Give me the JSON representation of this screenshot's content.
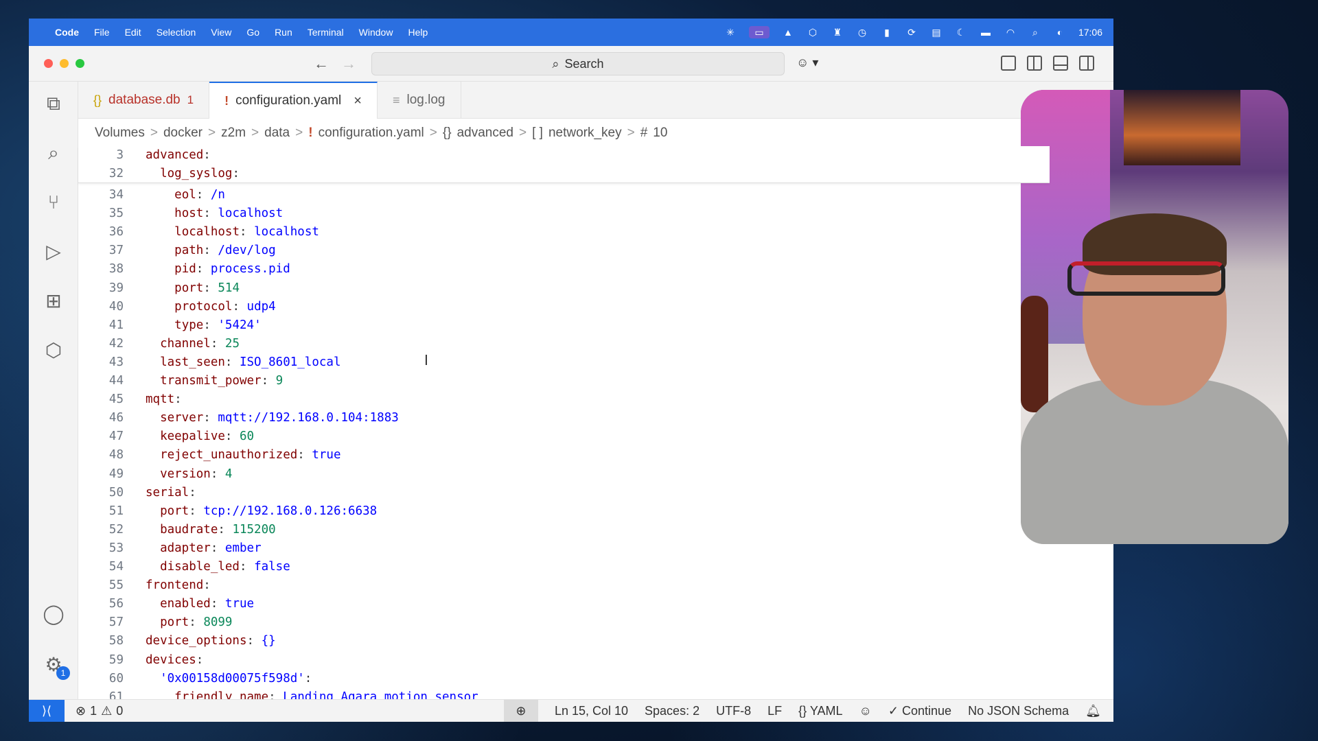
{
  "menubar": {
    "app": "Code",
    "items": [
      "File",
      "Edit",
      "Selection",
      "View",
      "Go",
      "Run",
      "Terminal",
      "Window",
      "Help"
    ],
    "clock": "17:06"
  },
  "titlebar": {
    "search_label": "Search"
  },
  "tabs": [
    {
      "label": "database.db",
      "icon": "{}",
      "badge": "1"
    },
    {
      "label": "configuration.yaml",
      "icon": "!",
      "close": "×"
    },
    {
      "label": "log.log",
      "icon": "≡"
    }
  ],
  "breadcrumbs": {
    "parts": [
      "Volumes",
      "docker",
      "z2m",
      "data"
    ],
    "file": "configuration.yaml",
    "symbol1": "advanced",
    "symbol2": "network_key",
    "symbol3": "10",
    "sym_obj": "{}",
    "sym_arr": "[ ]",
    "sym_num": "#",
    "sym_excl": "!",
    "separator": ">"
  },
  "editor": {
    "lines": [
      {
        "n": "3",
        "indent": "",
        "key": "advanced",
        "colon": ":",
        "val": "",
        "vtype": ""
      },
      {
        "n": "32",
        "indent": "  ",
        "key": "log_syslog",
        "colon": ":",
        "val": "",
        "vtype": ""
      },
      {
        "n": "34",
        "indent": "    ",
        "key": "eol",
        "colon": ": ",
        "val": "/n",
        "vtype": "val"
      },
      {
        "n": "35",
        "indent": "    ",
        "key": "host",
        "colon": ": ",
        "val": "localhost",
        "vtype": "val"
      },
      {
        "n": "36",
        "indent": "    ",
        "key": "localhost",
        "colon": ": ",
        "val": "localhost",
        "vtype": "val"
      },
      {
        "n": "37",
        "indent": "    ",
        "key": "path",
        "colon": ": ",
        "val": "/dev/log",
        "vtype": "val"
      },
      {
        "n": "38",
        "indent": "    ",
        "key": "pid",
        "colon": ": ",
        "val": "process.pid",
        "vtype": "val"
      },
      {
        "n": "39",
        "indent": "    ",
        "key": "port",
        "colon": ": ",
        "val": "514",
        "vtype": "num"
      },
      {
        "n": "40",
        "indent": "    ",
        "key": "protocol",
        "colon": ": ",
        "val": "udp4",
        "vtype": "val"
      },
      {
        "n": "41",
        "indent": "    ",
        "key": "type",
        "colon": ": ",
        "val": "'5424'",
        "vtype": "val"
      },
      {
        "n": "42",
        "indent": "  ",
        "key": "channel",
        "colon": ": ",
        "val": "25",
        "vtype": "num"
      },
      {
        "n": "43",
        "indent": "  ",
        "key": "last_seen",
        "colon": ": ",
        "val": "ISO_8601_local",
        "vtype": "val"
      },
      {
        "n": "44",
        "indent": "  ",
        "key": "transmit_power",
        "colon": ": ",
        "val": "9",
        "vtype": "num"
      },
      {
        "n": "45",
        "indent": "",
        "key": "mqtt",
        "colon": ":",
        "val": "",
        "vtype": ""
      },
      {
        "n": "46",
        "indent": "  ",
        "key": "server",
        "colon": ": ",
        "val": "mqtt://192.168.0.104:1883",
        "vtype": "val"
      },
      {
        "n": "47",
        "indent": "  ",
        "key": "keepalive",
        "colon": ": ",
        "val": "60",
        "vtype": "num"
      },
      {
        "n": "48",
        "indent": "  ",
        "key": "reject_unauthorized",
        "colon": ": ",
        "val": "true",
        "vtype": "val"
      },
      {
        "n": "49",
        "indent": "  ",
        "key": "version",
        "colon": ": ",
        "val": "4",
        "vtype": "num"
      },
      {
        "n": "50",
        "indent": "",
        "key": "serial",
        "colon": ":",
        "val": "",
        "vtype": ""
      },
      {
        "n": "51",
        "indent": "  ",
        "key": "port",
        "colon": ": ",
        "val": "tcp://192.168.0.126:6638",
        "vtype": "val"
      },
      {
        "n": "52",
        "indent": "  ",
        "key": "baudrate",
        "colon": ": ",
        "val": "115200",
        "vtype": "num"
      },
      {
        "n": "53",
        "indent": "  ",
        "key": "adapter",
        "colon": ": ",
        "val": "ember",
        "vtype": "val"
      },
      {
        "n": "54",
        "indent": "  ",
        "key": "disable_led",
        "colon": ": ",
        "val": "false",
        "vtype": "val"
      },
      {
        "n": "55",
        "indent": "",
        "key": "frontend",
        "colon": ":",
        "val": "",
        "vtype": ""
      },
      {
        "n": "56",
        "indent": "  ",
        "key": "enabled",
        "colon": ": ",
        "val": "true",
        "vtype": "val"
      },
      {
        "n": "57",
        "indent": "  ",
        "key": "port",
        "colon": ": ",
        "val": "8099",
        "vtype": "num"
      },
      {
        "n": "58",
        "indent": "",
        "key": "device_options",
        "colon": ": ",
        "val": "{}",
        "vtype": "val"
      },
      {
        "n": "59",
        "indent": "",
        "key": "devices",
        "colon": ":",
        "val": "",
        "vtype": ""
      },
      {
        "n": "60",
        "indent": "  ",
        "key": "'0x00158d00075f598d'",
        "colon": ":",
        "val": "",
        "vtype": ""
      },
      {
        "n": "61",
        "indent": "    ",
        "key": "friendly_name",
        "colon": ": ",
        "val": "Landing Aqara motion sensor",
        "vtype": "val"
      }
    ]
  },
  "statusbar": {
    "errors": "1",
    "warnings": "0",
    "position": "Ln 15, Col 10",
    "spaces": "Spaces: 2",
    "encoding": "UTF-8",
    "eol": "LF",
    "language_icon": "{}",
    "language": "YAML",
    "continue": "Continue",
    "schema": "No JSON Schema"
  },
  "activitybar": {
    "settings_badge": "1"
  },
  "colors": {
    "accent": "#1f6fe5",
    "menubar": "#2b6fe0",
    "key": "#800000",
    "value": "#0000ff",
    "number": "#098658"
  }
}
